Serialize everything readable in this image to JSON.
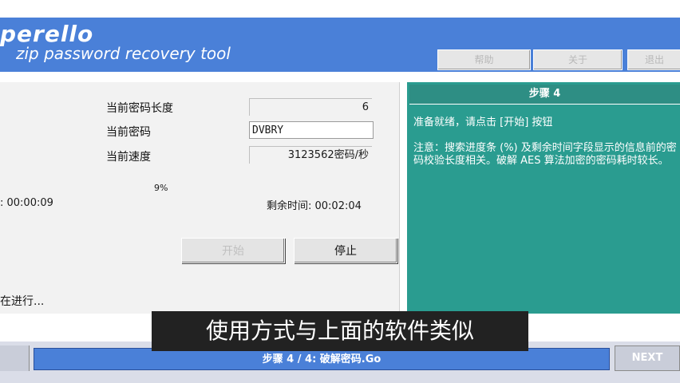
{
  "header": {
    "logo": "perello",
    "tagline": "zip password recovery tool",
    "buttons": [
      "帮助",
      "关于",
      "退出"
    ]
  },
  "progress_panel": {
    "length_label": "当前密码长度",
    "length_value": "6",
    "password_label": "当前密码",
    "password_value": "DVBRY",
    "speed_label": "当前速度",
    "speed_value": "3123562密码/秒",
    "percent": "9%",
    "elapsed": ": 00:00:09",
    "remaining": "剩余时间:  00:02:04",
    "start_button": "开始",
    "stop_button": "停止"
  },
  "info_panel": {
    "title": "步骤 4",
    "line1": "准备就绪，请点击 [开始] 按钮",
    "note": "注意：搜索进度条 (%) 及剩余时间字段显示的信息前的密码校验长度相关。破解 AES 算法加密的密码耗时较长。"
  },
  "status_text": "在进行...",
  "footer": {
    "step_label": "步骤 4 / 4: 破解密码.Go",
    "next_button": "NEXT"
  },
  "subtitle": "使用方式与上面的软件类似",
  "colors": {
    "banner": "#4a80d8",
    "info_panel": "#2a9c90",
    "step_bar": "#4a80d8"
  }
}
